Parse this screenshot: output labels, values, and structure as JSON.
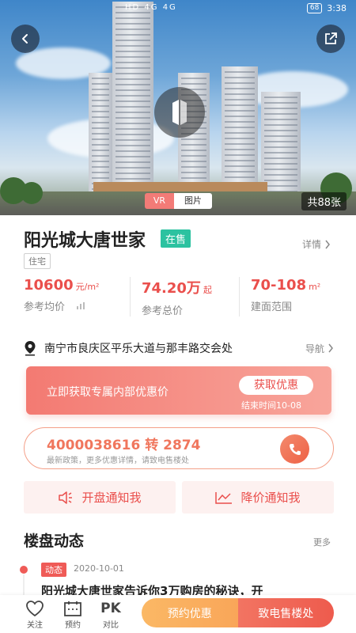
{
  "status_bar": {
    "time": "3:38",
    "battery": "68",
    "signal_text": "HD 4G 4G"
  },
  "hero": {
    "tab_vr": "VR",
    "tab_photos": "图片",
    "photo_count": "共88张"
  },
  "project": {
    "name": "阳光城大唐世家",
    "sale_status": "在售",
    "type_tag": "住宅",
    "details_label": "详情"
  },
  "stats": [
    {
      "value": "10600",
      "unit": "元/m²",
      "label": "参考均价"
    },
    {
      "value": "74.20万",
      "unit": "起",
      "label": "参考总价"
    },
    {
      "value": "70-108",
      "unit": "m²",
      "label": "建面范围"
    }
  ],
  "address": {
    "text": "南宁市良庆区平乐大道与那丰路交会处",
    "nav_label": "导航"
  },
  "promo": {
    "text": "立即获取专属内部优惠价",
    "button": "获取优惠",
    "end_time": "结束时间10-08"
  },
  "hotline": {
    "number": "4000038616 转 2874",
    "sub": "最新政策，更多优惠详情，请致电售楼处"
  },
  "notify": {
    "opening": "开盘通知我",
    "price_drop": "降价通知我"
  },
  "news_section": {
    "title": "楼盘动态",
    "more": "更多",
    "items": [
      {
        "tag": "动态",
        "date": "2020-10-01",
        "title": "阳光城大唐世家告诉你3万购房的秘诀，开"
      }
    ]
  },
  "bottom_bar": {
    "favorite": "关注",
    "booking": "预约",
    "compare_icon": "PK",
    "compare": "对比",
    "reserve_discount": "预约优惠",
    "call_sales": "致电售楼处"
  },
  "colors": {
    "accent_red": "#ea4f4c",
    "badge_green": "#2cc2a0",
    "orange": "#f9a659"
  }
}
